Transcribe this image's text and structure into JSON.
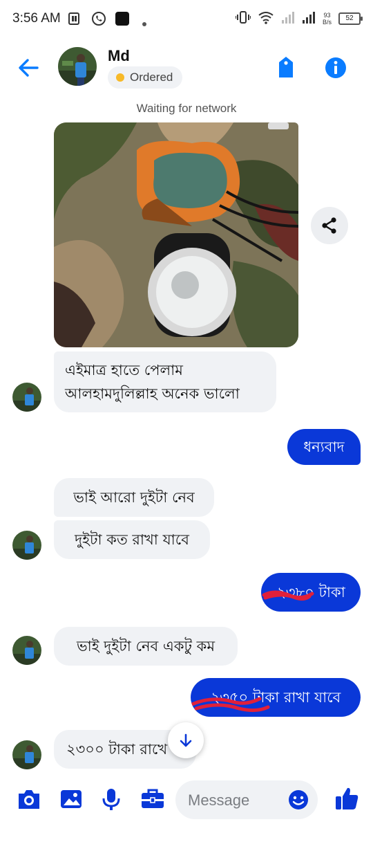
{
  "status_bar": {
    "time": "3:56 AM",
    "net_speed_value": "93",
    "net_speed_unit": "B/s",
    "battery": "52"
  },
  "header": {
    "contact_name": "Md",
    "tag_label": "Ordered"
  },
  "network_status": "Waiting for network",
  "messages": [
    {
      "dir": "in",
      "lines": [
        "এইমাত্র হাতে পেলাম",
        "আলহামদুলিল্লাহ অনেক ভালো"
      ]
    },
    {
      "dir": "out",
      "text": "ধন্যবাদ"
    },
    {
      "dir": "in",
      "text": "ভাই আরো দুইটা নেব"
    },
    {
      "dir": "in",
      "text": "দুইটা কত রাখা যাবে"
    },
    {
      "dir": "out",
      "text": "২৩৮০ টাকা"
    },
    {
      "dir": "in",
      "text": "ভাই দুইটা নেব একটু কম"
    },
    {
      "dir": "out",
      "text": "২৩৫০ টাকা রাখা যাবে"
    },
    {
      "dir": "in",
      "text": "২৩০০ টাকা রাখে"
    }
  ],
  "composer": {
    "placeholder": "Message"
  },
  "colors": {
    "accent": "#0a7cff",
    "outgoing_bubble": "#0a38d8",
    "incoming_bubble": "#f0f2f5",
    "tag_dot": "#f7b928",
    "scribble": "#e0203a"
  }
}
